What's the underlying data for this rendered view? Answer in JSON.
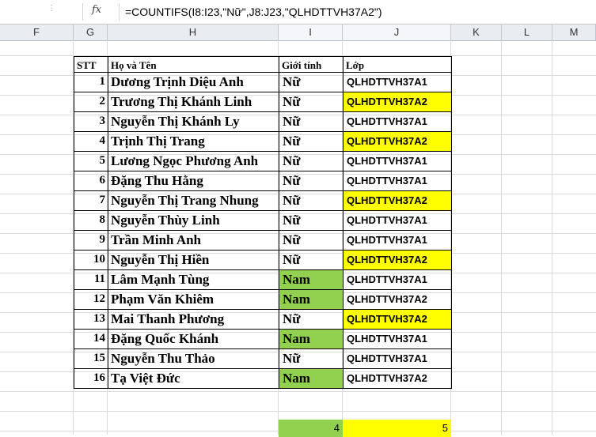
{
  "formula_bar": {
    "fx_label": "fx",
    "formula": "=COUNTIFS(I8:I23,\"Nữ\",J8:J23,\"QLHDTTVH37A2\")"
  },
  "columns": [
    "F",
    "G",
    "H",
    "I",
    "J",
    "K",
    "L",
    "M"
  ],
  "table": {
    "headers": {
      "stt": "STT",
      "name": "Họ và Tên",
      "gender": "Giới tính",
      "class": "Lớp"
    },
    "rows": [
      {
        "stt": "1",
        "name": "Dương Trịnh Diệu Anh",
        "gender": "Nữ",
        "class": "QLHDTTVH37A1"
      },
      {
        "stt": "2",
        "name": "Trương Thị Khánh Linh",
        "gender": "Nữ",
        "class": "QLHDTTVH37A2"
      },
      {
        "stt": "3",
        "name": "Nguyễn Thị Khánh Ly",
        "gender": "Nữ",
        "class": "QLHDTTVH37A1"
      },
      {
        "stt": "4",
        "name": "Trịnh Thị Trang",
        "gender": "Nữ",
        "class": "QLHDTTVH37A2"
      },
      {
        "stt": "5",
        "name": "Lương Ngọc Phương Anh",
        "gender": "Nữ",
        "class": "QLHDTTVH37A1"
      },
      {
        "stt": "6",
        "name": "Đặng Thu Hằng",
        "gender": "Nữ",
        "class": "QLHDTTVH37A1"
      },
      {
        "stt": "7",
        "name": "Nguyễn Thị Trang Nhung",
        "gender": "Nữ",
        "class": "QLHDTTVH37A2"
      },
      {
        "stt": "8",
        "name": "Nguyễn Thùy Linh",
        "gender": "Nữ",
        "class": "QLHDTTVH37A1"
      },
      {
        "stt": "9",
        "name": "Trần Minh Anh",
        "gender": "Nữ",
        "class": "QLHDTTVH37A1"
      },
      {
        "stt": "10",
        "name": "Nguyễn Thị Hiền",
        "gender": "Nữ",
        "class": "QLHDTTVH37A2"
      },
      {
        "stt": "11",
        "name": "Lâm Mạnh Tùng",
        "gender": "Nam",
        "class": "QLHDTTVH37A1"
      },
      {
        "stt": "12",
        "name": "Phạm Văn Khiêm",
        "gender": "Nam",
        "class": "QLHDTTVH37A2"
      },
      {
        "stt": "13",
        "name": "Mai Thanh Phương",
        "gender": "Nữ",
        "class": "QLHDTTVH37A2"
      },
      {
        "stt": "14",
        "name": "Đặng Quốc Khánh",
        "gender": "Nam",
        "class": "QLHDTTVH37A1"
      },
      {
        "stt": "15",
        "name": "Nguyễn Thu Thảo",
        "gender": "Nữ",
        "class": "QLHDTTVH37A1"
      },
      {
        "stt": "16",
        "name": "Tạ Việt Đức",
        "gender": "Nam",
        "class": "QLHDTTVH37A2"
      }
    ]
  },
  "highlight": {
    "green_color": "#92d050",
    "yellow_color": "#ffff00",
    "yellow_rows": [
      2,
      4,
      7,
      10,
      13
    ]
  },
  "totals": {
    "i_result": "4",
    "j_result": "5"
  }
}
